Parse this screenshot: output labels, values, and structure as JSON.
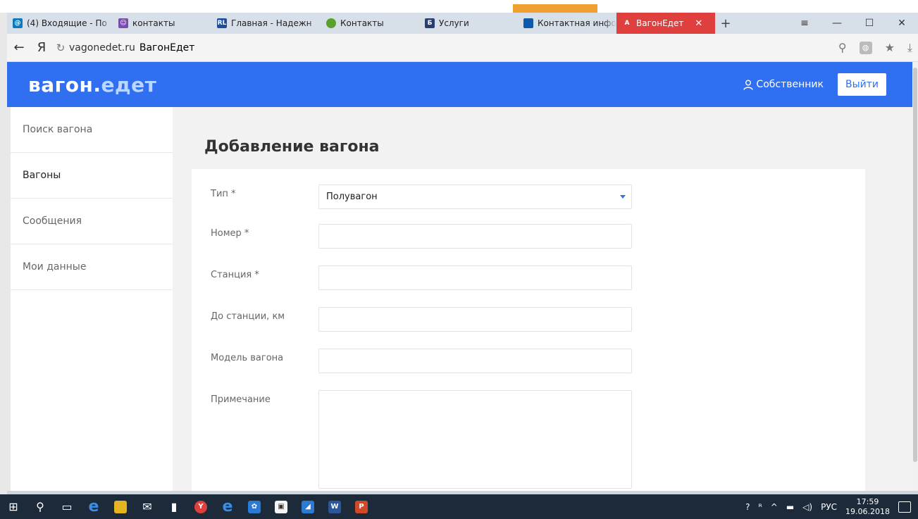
{
  "browser": {
    "tabs": [
      {
        "label": "(4) Входящие - По",
        "icon": "mail-icon",
        "color": "#0a7abf"
      },
      {
        "label": "контакты",
        "icon": "contacts-icon",
        "color": "#7b4bb0"
      },
      {
        "label": "Главная - Надежн",
        "icon": "rl-icon",
        "color": "#1a4fa0",
        "glyph": "RL"
      },
      {
        "label": "Контакты",
        "icon": "leaf-icon",
        "color": "#5aa02c"
      },
      {
        "label": "Услуги",
        "icon": "e-icon",
        "color": "#2b3e70",
        "glyph": "Б"
      },
      {
        "label": "Контактная инфо",
        "icon": "site-icon",
        "color": "#0f5aa8"
      },
      {
        "label": "ВагонЕдет",
        "icon": "a-icon",
        "color": "#e0403d",
        "glyph": "A"
      }
    ],
    "address_domain": "vagonedet.ru",
    "address_title": "ВагонЕдет"
  },
  "site": {
    "logo_main": "вагон.",
    "logo_accent": "едет",
    "owner_label": "Собственник",
    "logout_label": "Выйти"
  },
  "sidebar": {
    "items": [
      {
        "label": "Поиск вагона"
      },
      {
        "label": "Вагоны"
      },
      {
        "label": "Сообщения"
      },
      {
        "label": "Мои данные"
      }
    ]
  },
  "form": {
    "title": "Добавление вагона",
    "fields": [
      {
        "label": "Тип *",
        "value": "Полувагон"
      },
      {
        "label": "Номер *",
        "value": ""
      },
      {
        "label": "Станция *",
        "value": ""
      },
      {
        "label": "До станции, км",
        "value": ""
      },
      {
        "label": "Модель вагона",
        "value": ""
      },
      {
        "label": "Примечание",
        "value": ""
      }
    ]
  },
  "taskbar": {
    "lang": "РУС",
    "time": "17:59",
    "date": "19.06.2018"
  }
}
